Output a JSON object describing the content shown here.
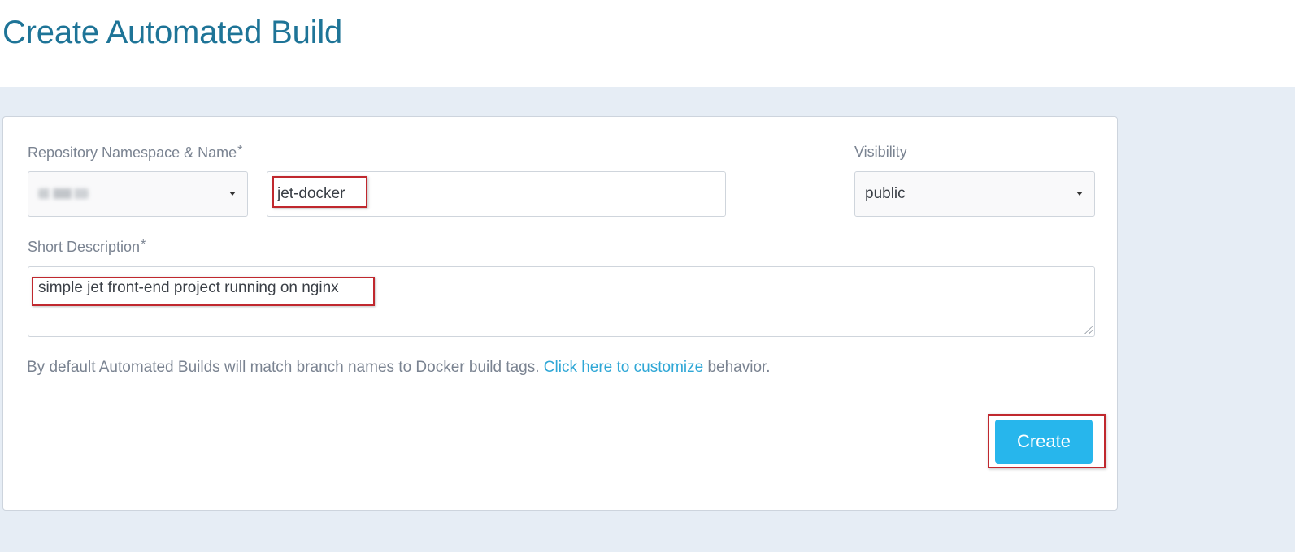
{
  "colors": {
    "title": "#1e7497",
    "page_background": "#e6edf5",
    "card_background": "#ffffff",
    "label": "#7a8391",
    "link": "#2fa7d6",
    "primary_button": "#27b6ec",
    "highlight": "#c0282e"
  },
  "header": {
    "title": "Create Automated Build"
  },
  "form": {
    "repository": {
      "label": "Repository Namespace & Name",
      "required_mark": "*",
      "namespace_select": {
        "selected_value": "",
        "value_obscured": true,
        "icon": "caret-down-icon"
      },
      "name_input": {
        "value": "jet-docker"
      }
    },
    "visibility": {
      "label": "Visibility",
      "selected_value": "public",
      "icon": "caret-down-icon"
    },
    "short_description": {
      "label": "Short Description",
      "required_mark": "*",
      "value": "simple jet front-end project running on nginx"
    },
    "help": {
      "text_before": "By default Automated Builds will match branch names to Docker build tags.",
      "link_text": "Click here to customize",
      "text_after": "behavior."
    },
    "create_button": {
      "label": "Create"
    }
  }
}
